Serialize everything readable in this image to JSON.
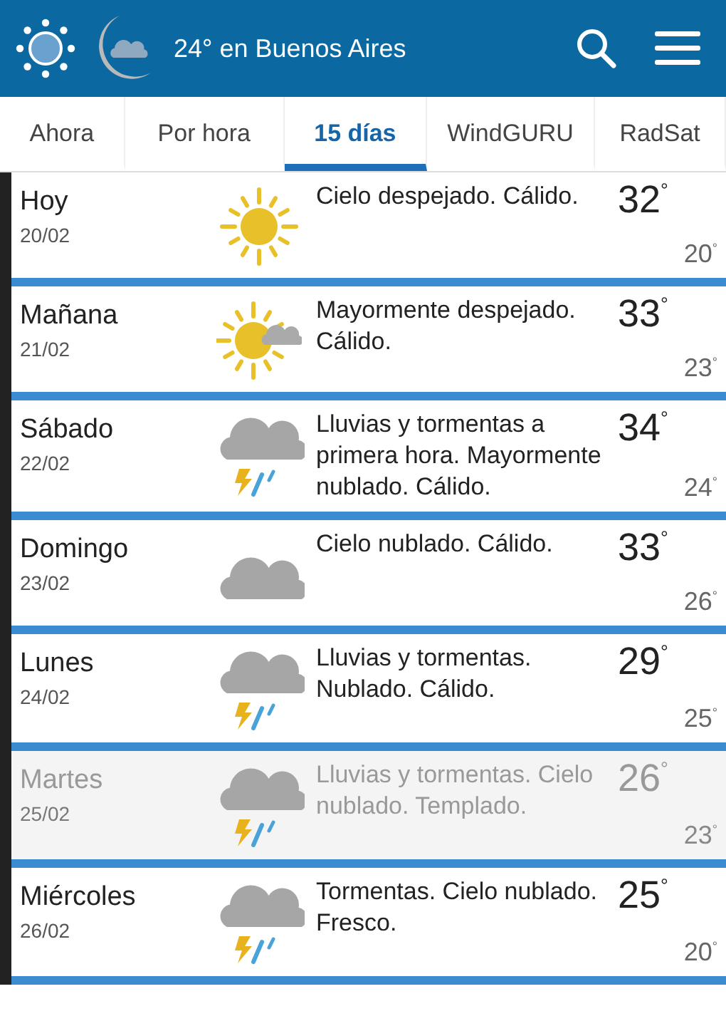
{
  "header": {
    "title": "24° en Buenos Aires"
  },
  "tabs": [
    {
      "label": "Ahora",
      "selected": false
    },
    {
      "label": "Por hora",
      "selected": false
    },
    {
      "label": "15 días",
      "selected": true
    },
    {
      "label": "WindGURU",
      "selected": false
    },
    {
      "label": "RadSat",
      "selected": false
    }
  ],
  "days": [
    {
      "day": "Hoy",
      "date": "20/02",
      "kind": "clear",
      "summary": "Cielo despejado. Cálido.",
      "high": "32$^{°}$",
      "low": "20$^{°}$",
      "faded": false
    },
    {
      "day": "Mañana",
      "date": "21/02",
      "kind": "partly-cloudy",
      "summary": "Mayormente despejado. Cálido.",
      "high": "33$^{°}$",
      "low": "23$^{°}$",
      "faded": false
    },
    {
      "day": "Sábado",
      "date": "22/02",
      "kind": "storm",
      "summary": "Lluvias y tormentas a primera hora. Mayormente nublado. Cálido.",
      "high": "34$^{°}$",
      "low": "24$^{°}$",
      "faded": false
    },
    {
      "day": "Domingo",
      "date": "23/02",
      "kind": "cloudy",
      "summary": "Cielo nublado. Cálido.",
      "high": "33$^{°}$",
      "low": "26$^{°}$",
      "faded": false
    },
    {
      "day": "Lunes",
      "date": "24/02",
      "kind": "storm",
      "summary": "Lluvias y tormentas. Nublado. Cálido.",
      "high": "29$^{°}$",
      "low": "25$^{°}$",
      "faded": false
    },
    {
      "day": "Martes",
      "date": "25/02",
      "kind": "storm",
      "summary": "Lluvias y tormentas. Cielo nublado. Templado.",
      "high": "26$^{°}$",
      "low": "23$^{°}$",
      "faded": true
    },
    {
      "day": "Miércoles",
      "date": "26/02",
      "kind": "storm",
      "summary": "Tormentas. Cielo nublado. Fresco.",
      "high": "25$^{°}$",
      "low": "20$^{°}$",
      "faded": false
    }
  ]
}
